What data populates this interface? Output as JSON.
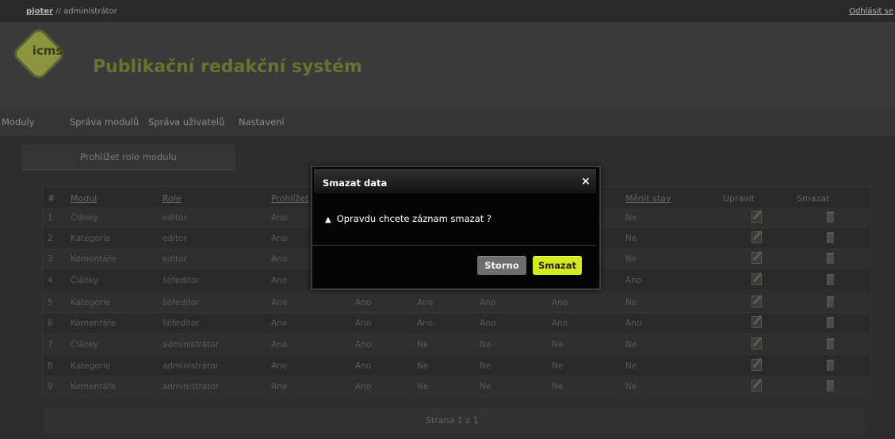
{
  "topbar": {
    "username": "pjoter",
    "separator": "//",
    "role": "administrátor",
    "logout": "Odhlásit se"
  },
  "header": {
    "logo_text": "icms",
    "title": "Publikační redakční systém"
  },
  "nav": {
    "items": [
      "Moduly",
      "Správa modulů",
      "Správa uživatelů",
      "Nastavení"
    ]
  },
  "tab": {
    "label": "Prohlížet role modulu"
  },
  "table": {
    "headers": [
      "#",
      "Modul",
      "Role",
      "Prohlížet",
      "",
      "",
      "",
      "",
      "Měnit stav",
      "Upravit",
      "Smazat"
    ],
    "rows": [
      [
        "1",
        "Články",
        "editor",
        "Ano",
        "",
        "",
        "",
        "",
        "Ne"
      ],
      [
        "2",
        "Kategorie",
        "editor",
        "Ano",
        "",
        "",
        "",
        "",
        "Ne"
      ],
      [
        "3",
        "Komentáře",
        "editor",
        "Ano",
        "",
        "",
        "",
        "",
        "Ne"
      ],
      [
        "4",
        "Články",
        "šéfeditor",
        "Ano",
        "",
        "",
        "",
        "",
        "Ano"
      ],
      [
        "5",
        "Kategorie",
        "šéfeditor",
        "Ano",
        "Ano",
        "Ano",
        "Ano",
        "Ano",
        "Ne"
      ],
      [
        "6",
        "Komentáře",
        "šéfeditor",
        "Ano",
        "Ano",
        "Ano",
        "Ano",
        "Ano",
        "Ano"
      ],
      [
        "7",
        "Články",
        "administrátor",
        "Ano",
        "Ano",
        "Ne",
        "Ne",
        "Ne",
        "Ne"
      ],
      [
        "8",
        "Kategorie",
        "administrátor",
        "Ano",
        "Ano",
        "Ne",
        "Ne",
        "Ne",
        "Ne"
      ],
      [
        "9",
        "Komentáře",
        "administrátor",
        "Ano",
        "Ano",
        "Ne",
        "Ne",
        "Ne",
        "Ne"
      ]
    ]
  },
  "pager": {
    "text": "Strana 1 z 1"
  },
  "modal": {
    "title": "Smazat data",
    "close": "×",
    "message": "Opravdu chcete záznam smazat ?",
    "cancel_label": "Storno",
    "delete_label": "Smazat"
  },
  "icons": {
    "edit": "edit-icon",
    "delete": "trash-icon",
    "warning": "warning-icon",
    "close": "close-icon"
  },
  "colors": {
    "accent": "#d4ea1a",
    "title": "#6b7230"
  }
}
